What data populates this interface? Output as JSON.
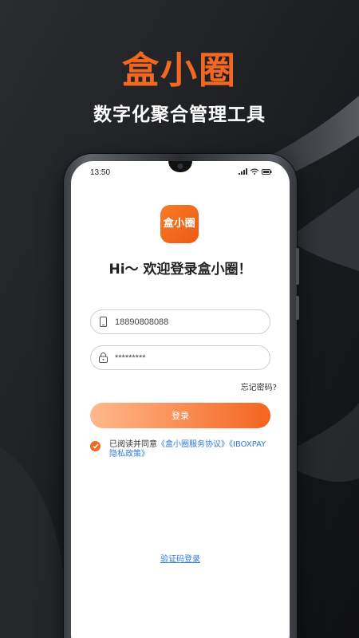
{
  "banner": {
    "title": "盒小圈",
    "subtitle": "数字化聚合管理工具"
  },
  "phone": {
    "status_time": "13:50",
    "app_icon_text": "盒小圈",
    "welcome": "Hi～ 欢迎登录盒小圈！",
    "phone_field_value": "18890808088",
    "password_field_value": "*********",
    "forgot_password": "忘记密码?",
    "login_button": "登录",
    "agreement": {
      "prefix": "已阅读并同意",
      "service_link": "《盒小圈服务协议》",
      "privacy_link": "《IBOXPAY隐私政策》",
      "checked": true
    },
    "sms_login": "验证码登录"
  },
  "colors": {
    "accent": "#f26722",
    "link": "#2f7bd8",
    "background": "#1a1b1e"
  },
  "icons": [
    "phone-icon",
    "lock-icon",
    "signal-icon",
    "wifi-icon",
    "battery-icon",
    "check-icon"
  ]
}
